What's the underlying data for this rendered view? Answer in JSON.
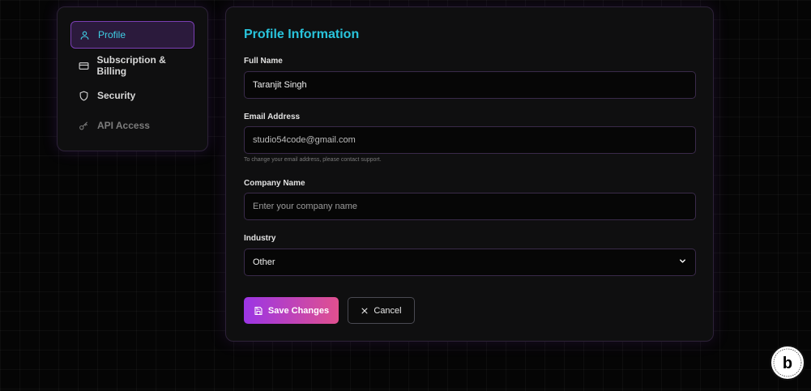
{
  "sidebar": {
    "items": [
      {
        "label": "Profile",
        "icon": "user-icon",
        "state": "active"
      },
      {
        "label": "Subscription & Billing",
        "icon": "credit-card-icon",
        "state": "normal"
      },
      {
        "label": "Security",
        "icon": "shield-icon",
        "state": "normal"
      },
      {
        "label": "API Access",
        "icon": "key-icon",
        "state": "disabled"
      }
    ]
  },
  "form": {
    "title": "Profile Information",
    "full_name": {
      "label": "Full Name",
      "value": "Taranjit Singh"
    },
    "email": {
      "label": "Email Address",
      "value": "studio54code@gmail.com",
      "help": "To change your email address, please contact support."
    },
    "company": {
      "label": "Company Name",
      "value": "",
      "placeholder": "Enter your company name"
    },
    "industry": {
      "label": "Industry",
      "value": "Other"
    },
    "save_label": "Save Changes",
    "cancel_label": "Cancel"
  },
  "badge": {
    "icon": "bolt-badge-icon",
    "letter": "b"
  },
  "colors": {
    "accent": "#29c4dc",
    "gradient_start": "#9b35e5",
    "gradient_end": "#e0508f",
    "background": "#050505"
  }
}
